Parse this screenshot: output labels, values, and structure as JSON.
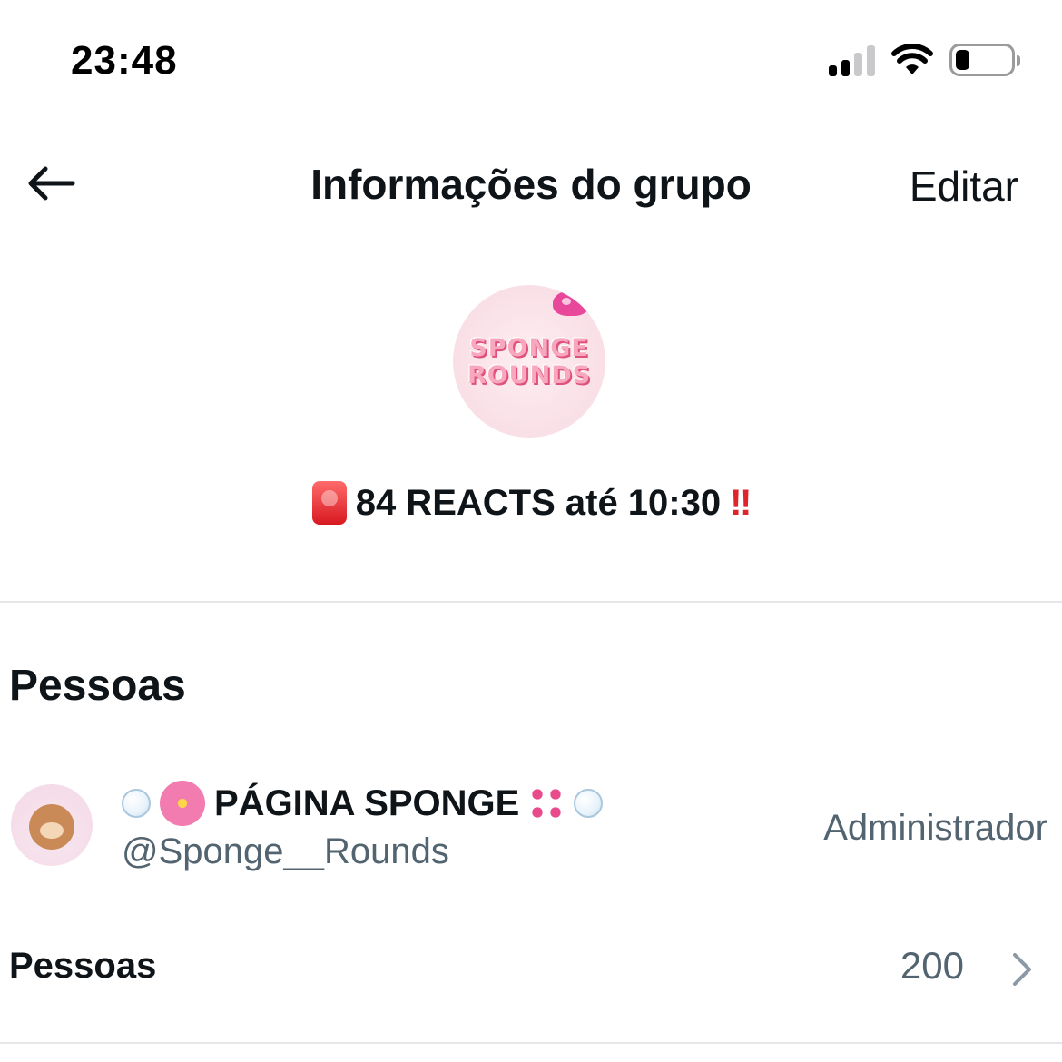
{
  "status_bar": {
    "time": "23:48",
    "icons": [
      "cellular-signal-icon",
      "wifi-icon",
      "battery-icon"
    ],
    "battery_level": 0.25
  },
  "header": {
    "back_icon": "arrow-left-icon",
    "title": "Informações do grupo",
    "edit_label": "Editar"
  },
  "group": {
    "avatar_text_line1": "SPONGE",
    "avatar_text_line2": "ROUNDS",
    "description": "84 REACTS até 10:30",
    "description_prefix_icon": "police-siren-icon",
    "description_suffix": "‼"
  },
  "people_section": {
    "title": "Pessoas",
    "members": [
      {
        "display_name": "PÁGINA SPONGE",
        "handle": "@Sponge__Rounds",
        "role": "Administrador",
        "icons": [
          "bubbles-icon",
          "cherry-blossom-icon",
          "bikini-icon",
          "bubbles-icon"
        ]
      }
    ],
    "count_label": "Pessoas",
    "count_value": "200",
    "chevron_icon": "chevron-right-icon"
  },
  "colors": {
    "text_primary": "#0f1419",
    "text_secondary": "#536471",
    "divider": "#e7e7e9",
    "accent_red": "#e0242b"
  }
}
